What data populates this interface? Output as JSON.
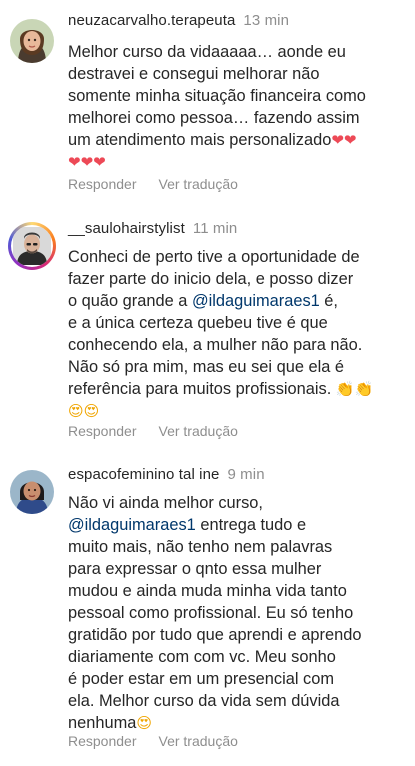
{
  "comments": [
    {
      "username": "neuzacarvalho.terapeuta",
      "time": "13 min",
      "lines": [
        "Melhor curso da vidaaaaa… aonde eu",
        "destravei e consegui melhorar não",
        "somente minha situação financeira como",
        "melhorei como pessoa… fazendo assim",
        "um atendimento mais personalizado"
      ],
      "reply": "Responder",
      "translate": "Ver tradução"
    },
    {
      "username": "__saulohairstylist",
      "time": "11 min",
      "lines": [
        "Conheci de perto tive a oportunidade de",
        "fazer parte do inicio dela, e posso dizer",
        "o quão grande a ",
        "@ildaguimaraes1",
        " é,",
        "e a única certeza quebeu tive é que",
        "conhecendo ela, a mulher não para não.",
        "Não só pra mim, mas eu sei que ela é",
        "referência para muitos profissionais."
      ],
      "reply": "Responder",
      "translate": "Ver tradução"
    },
    {
      "username": "espacofeminino tal ine",
      "time": "9 min",
      "lines": [
        "Não vi ainda melhor curso,",
        "@ildaguimaraes1",
        " entrega tudo e",
        "muito mais, não tenho nem palavras",
        "para expressar o qnto essa mulher",
        "mudou e ainda muda minha vida tanto",
        "pessoal como profissional. Eu só tenho",
        "gratidão por tudo que aprendi e aprendo",
        "diariamente com com vc. Meu sonho",
        "é poder estar em um presencial com",
        "ela. Melhor curso da vida sem dúvida",
        "nenhuma"
      ],
      "reply": "Responder",
      "translate": "Ver tradução"
    }
  ]
}
